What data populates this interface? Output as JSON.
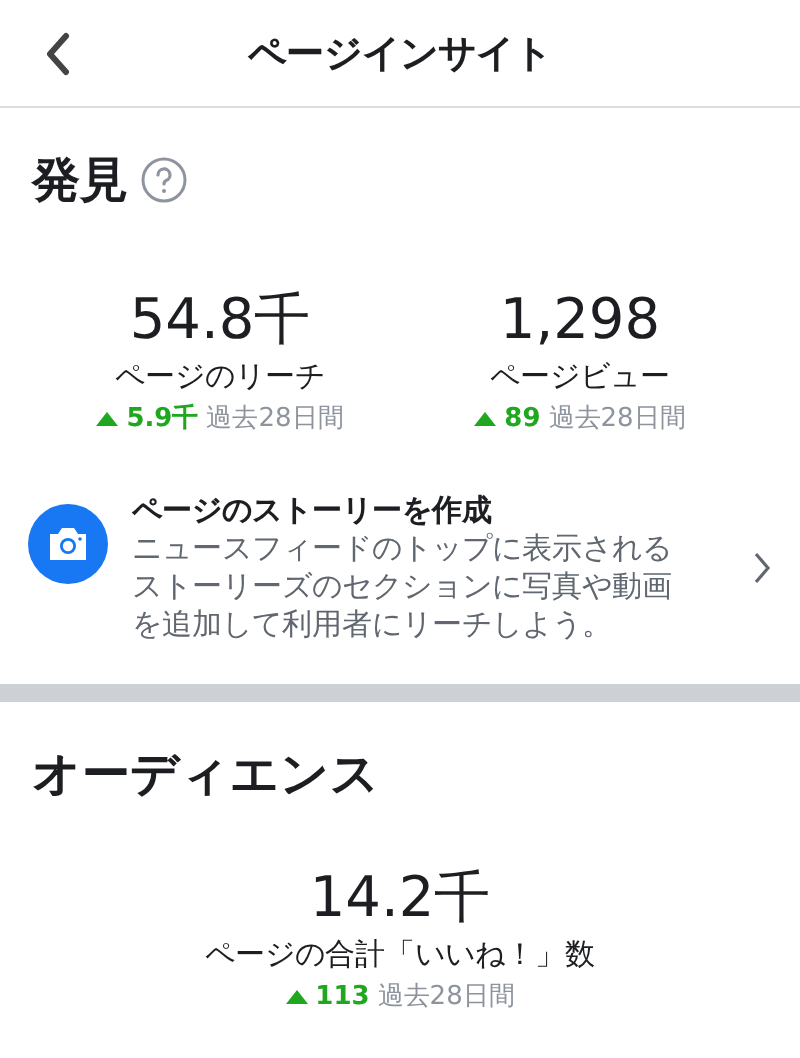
{
  "header": {
    "title": "ページインサイト"
  },
  "discovery": {
    "title": "発見",
    "metrics": [
      {
        "value": "54.8千",
        "label": "ページのリーチ",
        "change": "5.9千",
        "period": "過去28日間"
      },
      {
        "value": "1,298",
        "label": "ページビュー",
        "change": "89",
        "period": "過去28日間"
      }
    ],
    "story": {
      "title": "ページのストーリーを作成",
      "description": "ニュースフィードのトップに表示されるストーリーズのセクションに写真や動画を追加して利用者にリーチしよう。"
    }
  },
  "audience": {
    "title": "オーディエンス",
    "metrics": [
      {
        "value": "14.2千",
        "label": "ページの合計「いいね！」数",
        "change": "113",
        "period": "過去28日間"
      }
    ]
  }
}
